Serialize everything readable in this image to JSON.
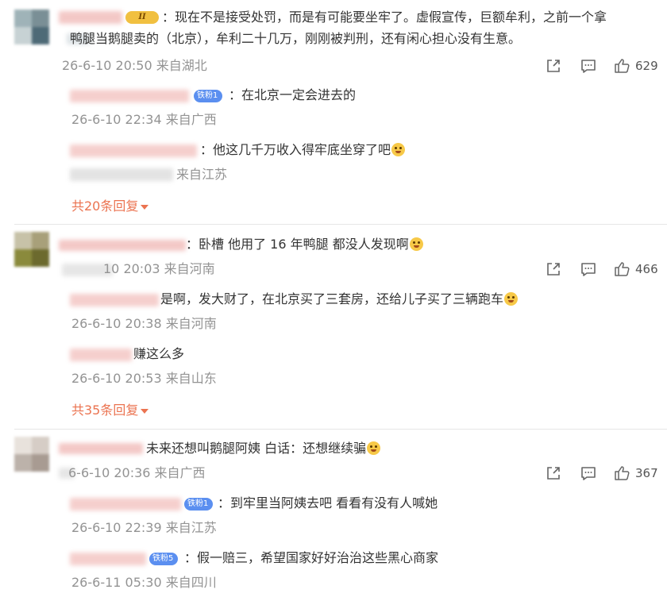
{
  "comments": [
    {
      "text": "：现在不是接受处罚，而是有可能要坐牢了。虚假宣传，巨额牟利，之前一个拿",
      "text_line2": "鸭腿当鹅腿卖的（北京），牟利二十几万，刚刚被判刑，还有闲心担心没有生意。",
      "vip_label": "II",
      "meta": "26-6-10 20:50 来自湖北",
      "likes": "629",
      "replies": [
        {
          "badge": "铁粉1",
          "text": "：在北京一定会进去的",
          "meta": "26-6-10 22:34 来自广西"
        },
        {
          "badge": "",
          "text": "：他这几千万收入得牢底坐穿了吧",
          "meta": "来自江苏"
        }
      ],
      "more_replies": "共20条回复"
    },
    {
      "text": "：卧槽 他用了 16 年鸭腿 都没人发现啊",
      "meta": "10 20:03 来自河南",
      "likes": "466",
      "replies": [
        {
          "badge": "",
          "text": "是啊，发大财了，在北京买了三套房，还给儿子买了三辆跑车",
          "meta": "26-6-10 20:38 来自河南"
        },
        {
          "badge": "",
          "text": "赚这么多",
          "meta": "26-6-10 20:53 来自山东"
        }
      ],
      "more_replies": "共35条回复"
    },
    {
      "text": "未来还想叫鹅腿阿姨 白话：还想继续骗",
      "meta": "6-6-10 20:36 来自广西",
      "likes": "367",
      "replies": [
        {
          "badge": "铁粉1",
          "text": "：到牢里当阿姨去吧 看看有没有人喊她",
          "meta": "26-6-10 22:39 来自江苏"
        },
        {
          "badge": "铁粉5",
          "text": "：假一赔三，希望国家好好治治这些黑心商家",
          "meta": "26-6-11 05:30 来自四川"
        }
      ]
    }
  ],
  "icons": {
    "share": "share-icon",
    "comment": "comment-icon",
    "like": "thumbs-up-icon"
  },
  "colors": {
    "link": "#eb7350",
    "meta": "#939393",
    "badge": "#5b8ff0",
    "vip": "#f1c040"
  }
}
